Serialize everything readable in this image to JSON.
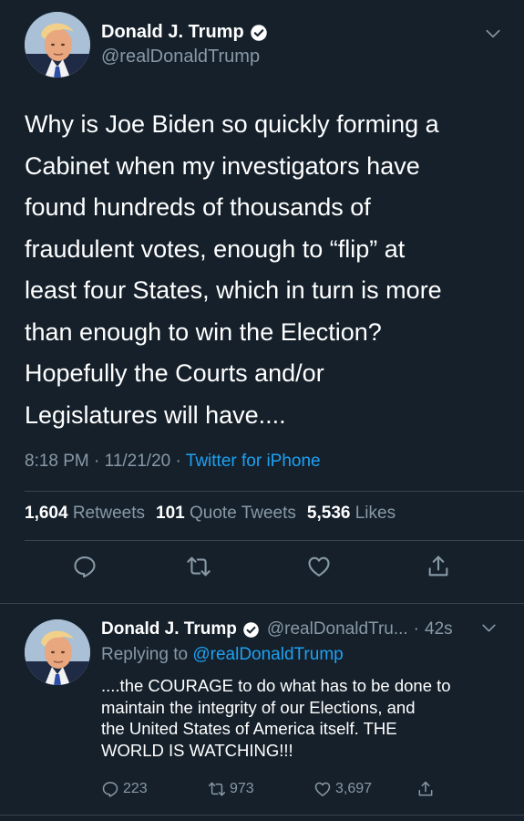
{
  "main_tweet": {
    "author_name": "Donald J. Trump",
    "author_handle": "@realDonaldTrump",
    "text": "Why is Joe Biden so quickly forming a\nCabinet when my investigators have\nfound hundreds of thousands of\nfraudulent votes, enough to “flip” at\nleast four States, which in turn is more\nthan enough to win the Election?\nHopefully the Courts and/or\nLegislatures will have....",
    "time": "8:18 PM",
    "date": "11/21/20",
    "separator": "·",
    "source": "Twitter for iPhone",
    "stats": {
      "retweets_count": "1,604",
      "retweets_label": "Retweets",
      "quote_tweets_count": "101",
      "quote_tweets_label": "Quote Tweets",
      "likes_count": "5,536",
      "likes_label": "Likes"
    },
    "actions": [
      "reply-icon",
      "retweet-icon",
      "like-icon",
      "share-icon"
    ]
  },
  "reply_tweet": {
    "author_name": "Donald J. Trump",
    "author_handle": "@realDonaldTru...",
    "separator": "·",
    "age": "42s",
    "replying_to_label": "Replying to",
    "replying_to_handle": "@realDonaldTrump",
    "text": "....the COURAGE to do what has to be done to\nmaintain the integrity of our Elections,  and\nthe United States of America itself. THE\nWORLD IS WATCHING!!!",
    "reply_count": "223",
    "retweet_count": "973",
    "like_count": "3,697"
  },
  "colors": {
    "background": "#15202b",
    "text_primary": "#ffffff",
    "text_secondary": "#8899a6",
    "accent": "#1da1f2",
    "divider": "#38444d"
  }
}
